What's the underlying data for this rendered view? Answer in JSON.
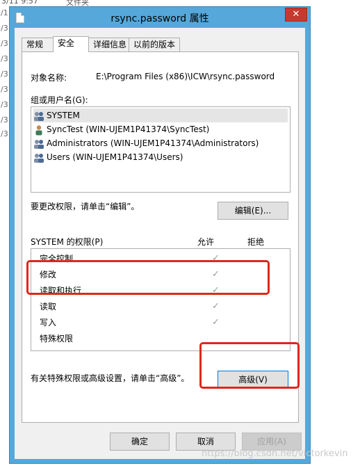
{
  "background": {
    "top_date": "3/11 9:57",
    "top_type": "文件夹",
    "left_items": [
      "/1",
      "/3",
      "/3",
      "/3",
      "/3",
      "/3",
      "/3",
      "/3",
      "/3"
    ]
  },
  "window": {
    "title": "rsync.password 属性",
    "close_symbol": "✕"
  },
  "tabs": [
    {
      "label": "常规"
    },
    {
      "label": "安全"
    },
    {
      "label": "详细信息"
    },
    {
      "label": "以前的版本"
    }
  ],
  "security": {
    "object_label": "对象名称:",
    "object_value": "E:\\Program Files (x86)\\ICW\\rsync.password",
    "group_label": "组或用户名(G):",
    "users": [
      {
        "name": "SYSTEM"
      },
      {
        "name": "SyncTest (WIN-UJEM1P41374\\SyncTest)"
      },
      {
        "name": "Administrators (WIN-UJEM1P41374\\Administrators)"
      },
      {
        "name": "Users (WIN-UJEM1P41374\\Users)"
      }
    ],
    "edit_hint": "要更改权限，请单击“编辑”。",
    "edit_button": "编辑(E)...",
    "perm_header": "SYSTEM 的权限(P)",
    "allow_header": "允许",
    "deny_header": "拒绝",
    "permissions": [
      {
        "name": "完全控制",
        "allow": "✓"
      },
      {
        "name": "修改",
        "allow": "✓"
      },
      {
        "name": "读取和执行",
        "allow": "✓"
      },
      {
        "name": "读取",
        "allow": "✓"
      },
      {
        "name": "写入",
        "allow": "✓"
      },
      {
        "name": "特殊权限",
        "allow": ""
      }
    ],
    "advanced_hint": "有关特殊权限或高级设置，请单击“高级”。",
    "advanced_button": "高级(V)"
  },
  "footer": {
    "ok": "确定",
    "cancel": "取消",
    "apply": "应用(A)"
  },
  "watermark": "https://blog.csdn.net/victorkevin",
  "colors": {
    "accent_frame": "#55a8d9",
    "close_button": "#c7392e",
    "annotation_red": "#e0261c"
  }
}
